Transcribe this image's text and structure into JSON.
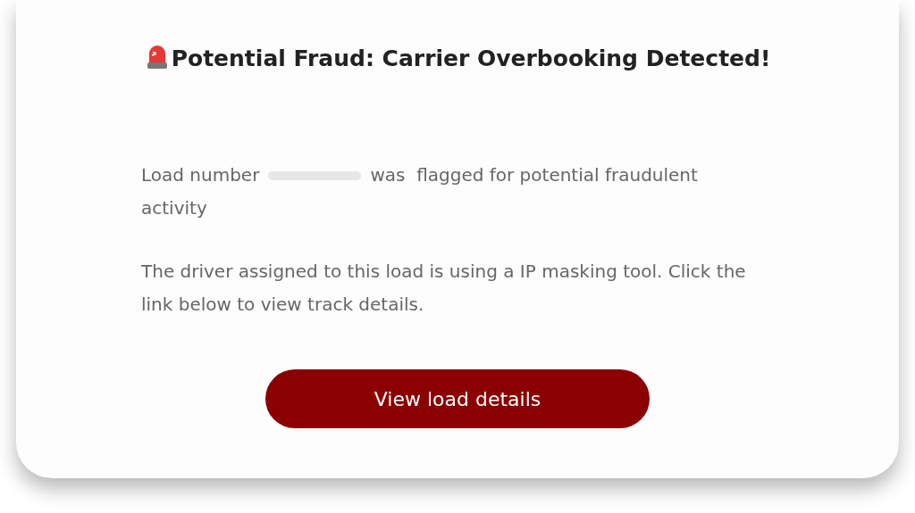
{
  "alert": {
    "title": "Potential Fraud: Carrier Overbooking Detected!",
    "flag_message": {
      "before": "Load number",
      "after": "was  flagged for potential fraudulent",
      "continuation": "activity"
    },
    "detail_message": "The driver assigned to this load is using a IP masking tool. Click the link below to view track details.",
    "button": "View load details"
  }
}
